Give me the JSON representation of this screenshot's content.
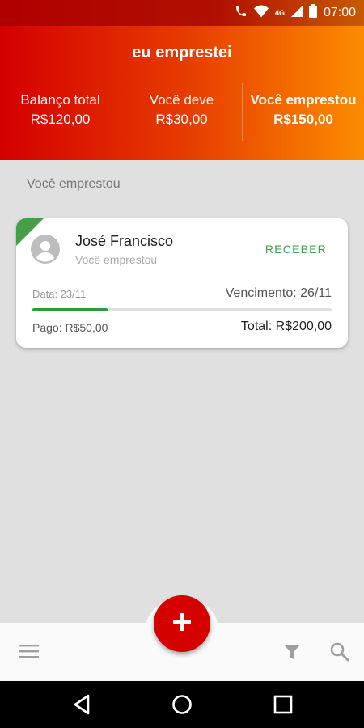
{
  "status_bar": {
    "time": "07:00",
    "network": "4G"
  },
  "header": {
    "title": "eu emprestei",
    "stats": [
      {
        "label": "Balanço total",
        "value": "R$120,00"
      },
      {
        "label": "Você deve",
        "value": "R$30,00"
      },
      {
        "label": "Você emprestou",
        "value": "R$150,00"
      }
    ]
  },
  "section": {
    "title": "Você emprestou"
  },
  "card": {
    "name": "José Francisco",
    "subtitle": "Você emprestou",
    "action_label": "RECEBER",
    "date": "Data: 23/11",
    "due": "Vencimento: 26/11",
    "paid": "Pago: R$50,00",
    "total": "Total: R$200,00",
    "progress_fraction": 0.25
  },
  "colors": {
    "header_start": "#d40000",
    "header_end": "#fb8c00",
    "accent_green": "#43a047",
    "fab": "#d50000"
  },
  "icons": {
    "menu": "menu-icon",
    "filter": "filter-icon",
    "search": "search-icon",
    "add": "plus-icon",
    "avatar": "account-circle-icon"
  }
}
